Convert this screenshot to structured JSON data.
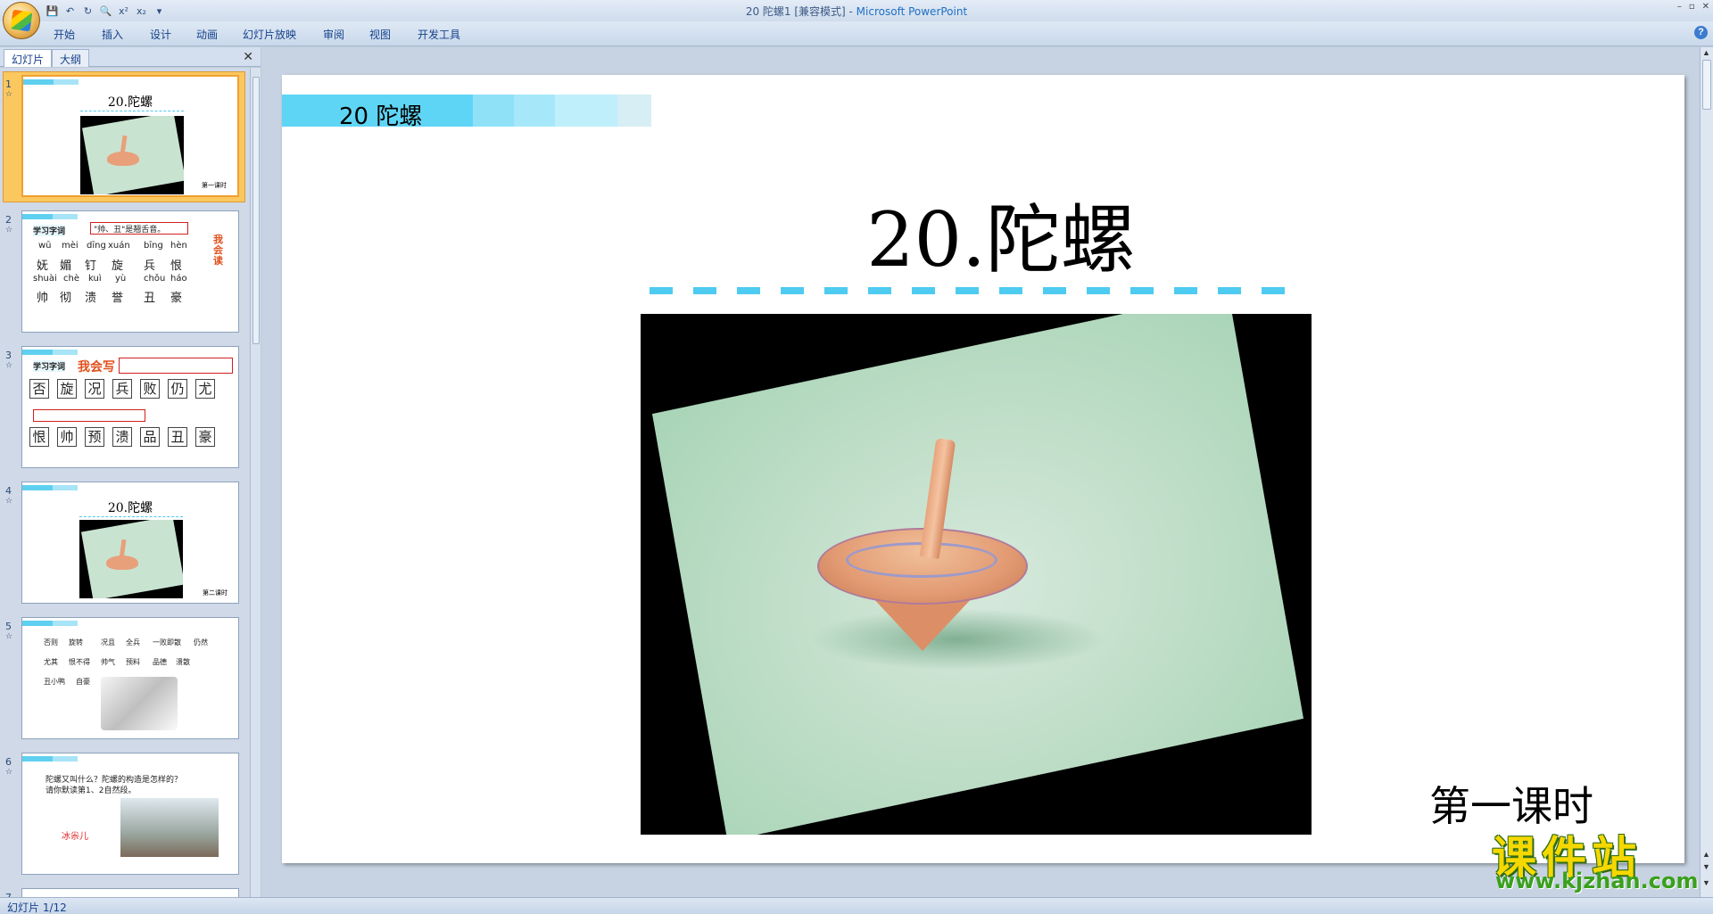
{
  "window": {
    "title": "20 陀螺1 [兼容模式] - ",
    "app_name": "Microsoft PowerPoint",
    "controls": [
      "–",
      "▫",
      "✕"
    ]
  },
  "quick_access": [
    "save-icon",
    "undo-icon",
    "redo-icon",
    "print-preview-icon",
    "superscript-icon",
    "subscript-icon",
    "customize-icon"
  ],
  "quick_access_glyphs": [
    "💾",
    "↶",
    "↻",
    "🔍",
    "x²",
    "x₂",
    "▾"
  ],
  "ribbon": {
    "tabs": [
      "开始",
      "插入",
      "设计",
      "动画",
      "幻灯片放映",
      "审阅",
      "视图",
      "开发工具"
    ],
    "help": "?"
  },
  "pane": {
    "tabs": [
      "幻灯片",
      "大纲"
    ],
    "close": "✕"
  },
  "thumbnails": [
    {
      "num": "1",
      "title": "20.陀螺",
      "corner": "第一课时"
    },
    {
      "num": "2",
      "label": "学习字词",
      "note": "\"帅、丑\"是翘舌音。",
      "side": "我会读",
      "pinyin1": [
        "wū",
        "mèi",
        "dīng",
        "xuán",
        "bīng",
        "hèn"
      ],
      "chars1": [
        "妩",
        "媚",
        "钉",
        "旋",
        "兵",
        "恨"
      ],
      "pinyin2": [
        "shuài",
        "chè",
        "kuì",
        "yù",
        "chǒu",
        "háo"
      ],
      "chars2": [
        "帅",
        "彻",
        "溃",
        "誉",
        "丑",
        "豪"
      ]
    },
    {
      "num": "3",
      "label": "学习字词",
      "side": "我会写",
      "row1": [
        "否",
        "旋",
        "况",
        "兵",
        "败",
        "仍",
        "尤"
      ],
      "row2": [
        "恨",
        "帅",
        "预",
        "溃",
        "品",
        "丑",
        "豪"
      ]
    },
    {
      "num": "4",
      "title": "20.陀螺",
      "corner": "第二课时"
    },
    {
      "num": "5",
      "words": [
        "否则",
        "旋转",
        "况且",
        "全兵",
        "一败即散",
        "仍然",
        "尤其",
        "恨不得",
        "帅气",
        "预料",
        "品德",
        "溃散",
        "丑小鸭",
        "自豪"
      ]
    },
    {
      "num": "6",
      "line1": "陀螺又叫什么？陀螺的构造是怎样的？",
      "line2": "请你默读第1、2自然段。",
      "red": "冰尜儿"
    },
    {
      "num": "7"
    }
  ],
  "slide": {
    "banner": "20 陀螺",
    "title": "20.陀螺",
    "lesson": "第一课时"
  },
  "status": {
    "slide_indicator": "幻灯片 1/12"
  },
  "watermark": {
    "brand": "课件站",
    "url": "www.kjzhan.com"
  },
  "colors": {
    "banner_blue": "#5fd5f5",
    "dash_blue": "#4ecbf0",
    "selection_orange": "#fbc85f"
  }
}
